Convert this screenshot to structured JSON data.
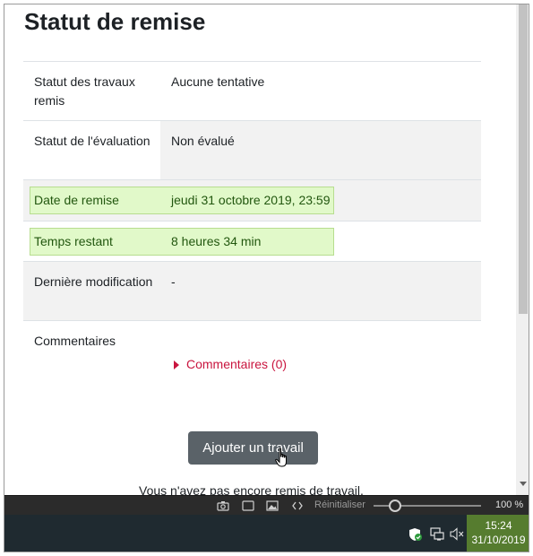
{
  "page": {
    "title": "Statut de remise",
    "rows": [
      {
        "label": "Statut des travaux remis",
        "value": "Aucune tentative"
      },
      {
        "label": "Statut de l'évaluation",
        "value": "Non évalué"
      },
      {
        "label": "Date de remise",
        "value": "jeudi 31 octobre 2019, 23:59"
      },
      {
        "label": "Temps restant",
        "value": "8 heures 34 min"
      },
      {
        "label": "Dernière modification",
        "value": "-"
      },
      {
        "label": "Commentaires",
        "link": "Commentaires (0)"
      }
    ],
    "add_button": "Ajouter un travail",
    "footer_text": "Vous n'avez pas encore remis de travail."
  },
  "statusbar": {
    "reset_label": "Réinitialiser",
    "zoom": "100 %",
    "zoom_level": 0.18
  },
  "taskbar": {
    "time": "15:24",
    "date": "31/10/2019"
  },
  "colors": {
    "accent_link": "#c9153f",
    "highlight_bg": "#e1f9c9",
    "button_bg": "#5a6268",
    "clock_bg": "#567c2f"
  }
}
